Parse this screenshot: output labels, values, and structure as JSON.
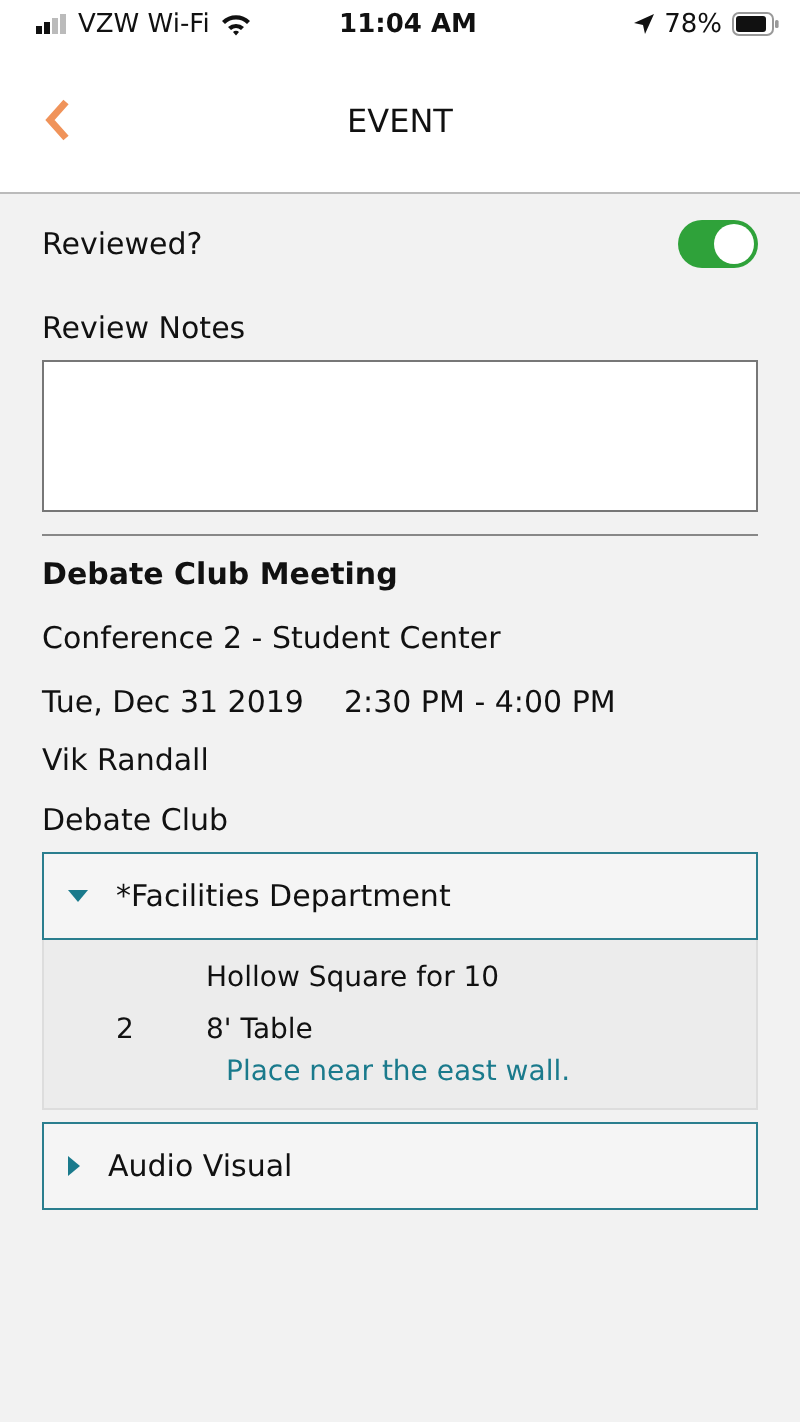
{
  "status_bar": {
    "carrier": "VZW Wi-Fi",
    "time": "11:04 AM",
    "battery": "78%"
  },
  "header": {
    "title": "EVENT"
  },
  "reviewed": {
    "label": "Reviewed?",
    "on": true
  },
  "review_notes": {
    "label": "Review Notes"
  },
  "event": {
    "title": "Debate Club Meeting",
    "location": "Conference 2 - Student Center",
    "date": "Tue, Dec 31 2019",
    "time": "2:30 PM - 4:00 PM",
    "contact": "Vik Randall",
    "organization": "Debate Club"
  },
  "sections": [
    {
      "name": "*Facilities Department",
      "expanded": true,
      "items": [
        {
          "title": "Hollow Square for 10",
          "quantity": "2",
          "name": "8' Table",
          "note": "Place near the east wall."
        }
      ]
    },
    {
      "name": "Audio Visual",
      "expanded": false
    }
  ]
}
